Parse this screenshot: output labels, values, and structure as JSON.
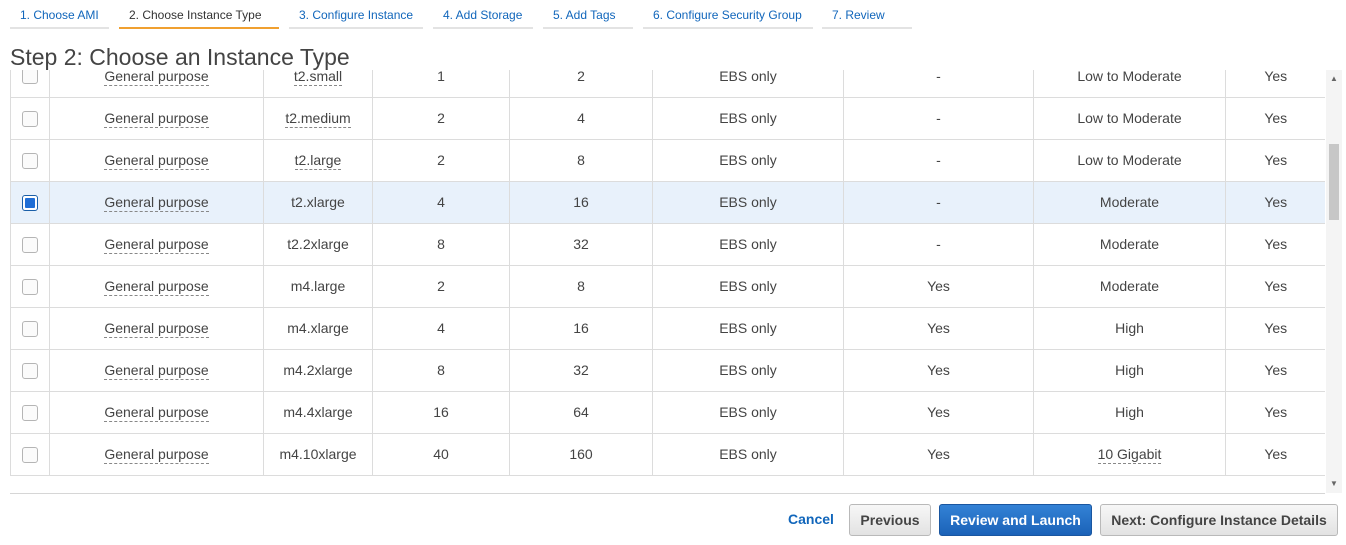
{
  "wizard": {
    "tabs": [
      {
        "label": "1. Choose AMI",
        "active": false
      },
      {
        "label": "2. Choose Instance Type",
        "active": true
      },
      {
        "label": "3. Configure Instance",
        "active": false
      },
      {
        "label": "4. Add Storage",
        "active": false
      },
      {
        "label": "5. Add Tags",
        "active": false
      },
      {
        "label": "6. Configure Security Group",
        "active": false
      },
      {
        "label": "7. Review",
        "active": false
      }
    ]
  },
  "page": {
    "title": "Step 2: Choose an Instance Type"
  },
  "colors": {
    "accent": "#1f6ed6",
    "active_tab": "#f0a030",
    "selected_row": "#e8f1fb",
    "link": "#1166bb"
  },
  "instances": [
    {
      "family": "General purpose",
      "type": "t2.small",
      "vcpus": "1",
      "memory": "2",
      "storage": "EBS only",
      "ebs_optimized": "-",
      "network": "Low to Moderate",
      "ipv6": "Yes",
      "selected": false
    },
    {
      "family": "General purpose",
      "type": "t2.medium",
      "vcpus": "2",
      "memory": "4",
      "storage": "EBS only",
      "ebs_optimized": "-",
      "network": "Low to Moderate",
      "ipv6": "Yes",
      "selected": false
    },
    {
      "family": "General purpose",
      "type": "t2.large",
      "vcpus": "2",
      "memory": "8",
      "storage": "EBS only",
      "ebs_optimized": "-",
      "network": "Low to Moderate",
      "ipv6": "Yes",
      "selected": false
    },
    {
      "family": "General purpose",
      "type": "t2.xlarge",
      "vcpus": "4",
      "memory": "16",
      "storage": "EBS only",
      "ebs_optimized": "-",
      "network": "Moderate",
      "ipv6": "Yes",
      "selected": true
    },
    {
      "family": "General purpose",
      "type": "t2.2xlarge",
      "vcpus": "8",
      "memory": "32",
      "storage": "EBS only",
      "ebs_optimized": "-",
      "network": "Moderate",
      "ipv6": "Yes",
      "selected": false
    },
    {
      "family": "General purpose",
      "type": "m4.large",
      "vcpus": "2",
      "memory": "8",
      "storage": "EBS only",
      "ebs_optimized": "Yes",
      "network": "Moderate",
      "ipv6": "Yes",
      "selected": false
    },
    {
      "family": "General purpose",
      "type": "m4.xlarge",
      "vcpus": "4",
      "memory": "16",
      "storage": "EBS only",
      "ebs_optimized": "Yes",
      "network": "High",
      "ipv6": "Yes",
      "selected": false
    },
    {
      "family": "General purpose",
      "type": "m4.2xlarge",
      "vcpus": "8",
      "memory": "32",
      "storage": "EBS only",
      "ebs_optimized": "Yes",
      "network": "High",
      "ipv6": "Yes",
      "selected": false
    },
    {
      "family": "General purpose",
      "type": "m4.4xlarge",
      "vcpus": "16",
      "memory": "64",
      "storage": "EBS only",
      "ebs_optimized": "Yes",
      "network": "High",
      "ipv6": "Yes",
      "selected": false
    },
    {
      "family": "General purpose",
      "type": "m4.10xlarge",
      "vcpus": "40",
      "memory": "160",
      "storage": "EBS only",
      "ebs_optimized": "Yes",
      "network": "10 Gigabit",
      "ipv6": "Yes",
      "selected": false
    }
  ],
  "footer": {
    "cancel": "Cancel",
    "previous": "Previous",
    "review_launch": "Review and Launch",
    "next": "Next: Configure Instance Details"
  },
  "icons": {
    "scroll_up": "triangle-up-icon",
    "scroll_down": "triangle-down-icon"
  }
}
